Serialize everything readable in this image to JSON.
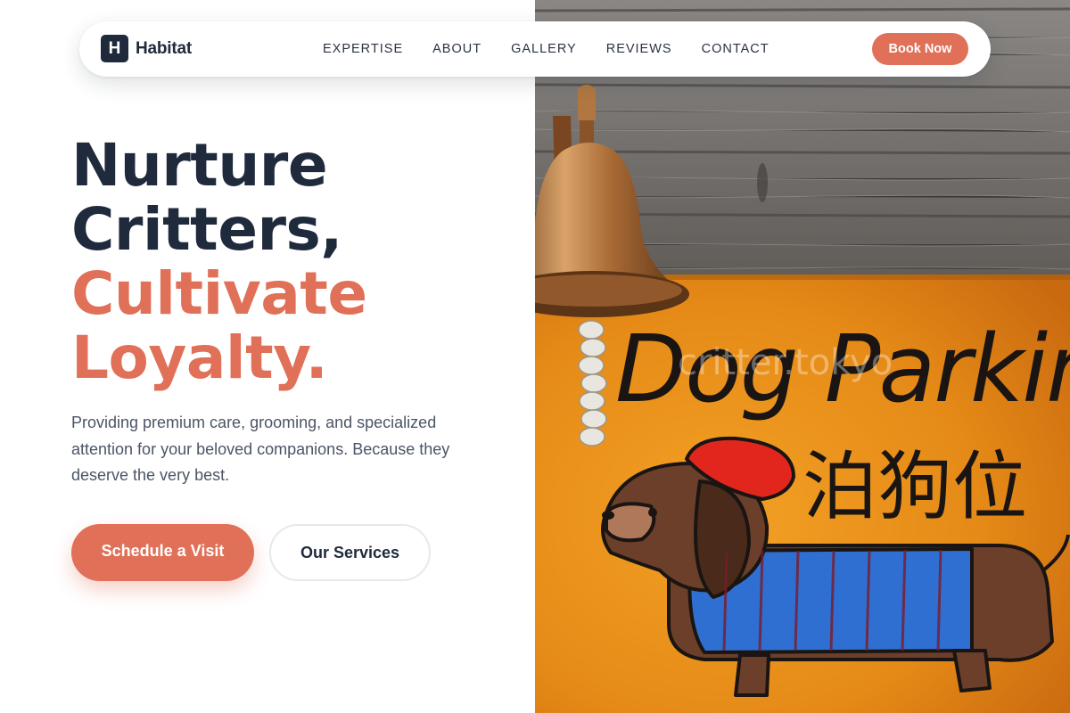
{
  "nav": {
    "logo_letter": "H",
    "brand": "Habitat",
    "links": [
      "EXPERTISE",
      "ABOUT",
      "GALLERY",
      "REVIEWS",
      "CONTACT"
    ],
    "cta": "Book Now"
  },
  "hero": {
    "headline_line1": "Nurture",
    "headline_line2": "Critters,",
    "headline_line3": "Cultivate",
    "headline_line4": "Loyalty.",
    "description": "Providing premium care, grooming, and specialized attention for your beloved companions. Because they deserve the very best.",
    "primary_button": "Schedule a Visit",
    "secondary_button": "Our Services"
  },
  "photo": {
    "sign_text": "Dog Parking",
    "sign_text_cjk": "泊狗位",
    "watermark": "critter.tokyo"
  },
  "colors": {
    "accent": "#e07058",
    "navy": "#1f2a3c",
    "text_muted": "#4b5566"
  }
}
